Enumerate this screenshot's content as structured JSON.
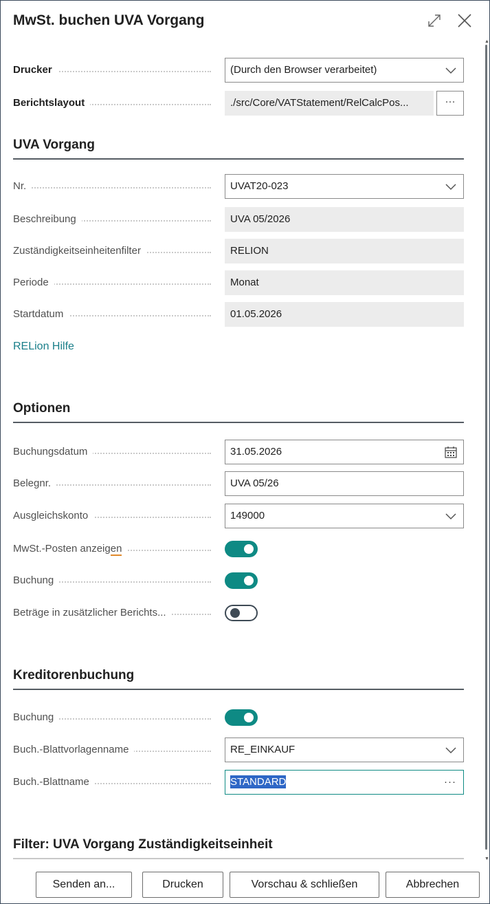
{
  "dialog": {
    "title": "MwSt. buchen UVA Vorgang"
  },
  "printer": {
    "drucker_label": "Drucker",
    "drucker_value": "(Durch den Browser verarbeitet)",
    "layout_label": "Berichtslayout",
    "layout_value": "./src/Core/VATStatement/RelCalcPos...",
    "layout_assist": "···"
  },
  "uva": {
    "section_title": "UVA Vorgang",
    "nr_label": "Nr.",
    "nr_value": "UVAT20-023",
    "beschreibung_label": "Beschreibung",
    "beschreibung_value": "UVA 05/2026",
    "filter_label": "Zuständigkeitseinheitenfilter",
    "filter_value": "RELION",
    "periode_label": "Periode",
    "periode_value": "Monat",
    "startdatum_label": "Startdatum",
    "startdatum_value": "01.05.2026",
    "help_link": "RELion Hilfe"
  },
  "optionen": {
    "section_title": "Optionen",
    "buchungsdatum_label": "Buchungsdatum",
    "buchungsdatum_value": "31.05.2026",
    "belegnr_label": "Belegnr.",
    "belegnr_value": "UVA 05/26",
    "ausgleichskonto_label": "Ausgleichskonto",
    "ausgleichskonto_value": "149000",
    "posten_label": "MwSt.-Posten anzeigen",
    "posten_label_main": "MwSt.-Posten anzeig",
    "posten_label_tail": "en",
    "posten_on": true,
    "buchung_label": "Buchung",
    "buchung_on": true,
    "betraege_label": "Beträge in zusätzlicher Berichts...",
    "betraege_on": false
  },
  "kreditor": {
    "section_title": "Kreditorenbuchung",
    "buchung_label": "Buchung",
    "buchung_on": true,
    "vorlage_label": "Buch.-Blattvorlagenname",
    "vorlage_value": "RE_EINKAUF",
    "blattname_label": "Buch.-Blattname",
    "blattname_value": "STANDARD",
    "blattname_assist": "···"
  },
  "filter_section": {
    "title": "Filter: UVA Vorgang Zuständigkeitseinheit"
  },
  "footer": {
    "senden": "Senden an...",
    "drucken": "Drucken",
    "vorschau": "Vorschau & schließen",
    "abbrechen": "Abbrechen"
  },
  "colors": {
    "accent": "#0e8a84",
    "link": "#1a7f8a",
    "selection": "#2e67c6"
  }
}
